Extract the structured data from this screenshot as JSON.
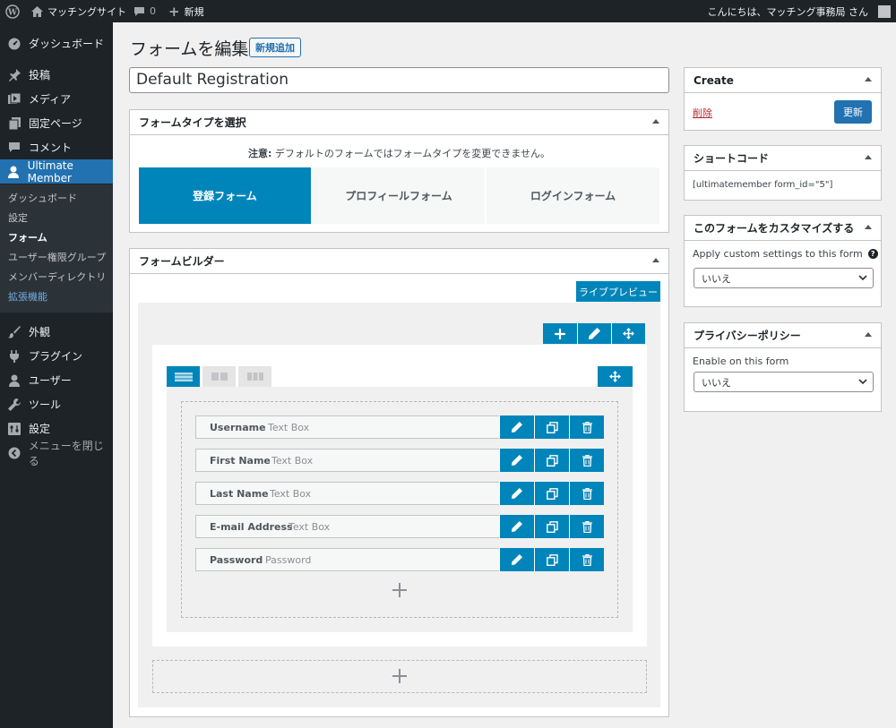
{
  "admin_bar": {
    "site_name": "マッチングサイト",
    "comments_count": "0",
    "new_label": "新規",
    "greeting": "こんにちは、マッチング事務局 さん"
  },
  "sidebar": {
    "items": [
      {
        "label": "ダッシュボード",
        "icon": "dashboard-icon"
      },
      {
        "label": "投稿",
        "icon": "pin-icon"
      },
      {
        "label": "メディア",
        "icon": "media-icon"
      },
      {
        "label": "固定ページ",
        "icon": "page-icon"
      },
      {
        "label": "コメント",
        "icon": "comment-icon"
      },
      {
        "label": "Ultimate Member",
        "icon": "user-icon"
      }
    ],
    "submenu": [
      "ダッシュボード",
      "設定",
      "フォーム",
      "ユーザー権限グループ",
      "メンバーディレクトリ",
      "拡張機能"
    ],
    "items2": [
      {
        "label": "外観",
        "icon": "brush-icon"
      },
      {
        "label": "プラグイン",
        "icon": "plugin-icon"
      },
      {
        "label": "ユーザー",
        "icon": "user-icon"
      },
      {
        "label": "ツール",
        "icon": "wrench-icon"
      },
      {
        "label": "設定",
        "icon": "settings-icon"
      }
    ],
    "collapse_label": "メニューを閉じる"
  },
  "page": {
    "title": "フォームを編集",
    "add_new": "新規追加",
    "form_title": "Default Registration"
  },
  "form_type": {
    "heading": "フォームタイプを選択",
    "notice_label": "注意:",
    "notice_text": " デフォルトのフォームではフォームタイプを変更できません。",
    "types": [
      "登録フォーム",
      "プロフィールフォーム",
      "ログインフォーム"
    ],
    "selected": "登録フォーム"
  },
  "builder": {
    "heading": "フォームビルダー",
    "live_preview": "ライブプレビュー",
    "fields": [
      {
        "label": "Username",
        "type": "Text Box"
      },
      {
        "label": "First Name",
        "type": "Text Box"
      },
      {
        "label": "Last Name",
        "type": "Text Box"
      },
      {
        "label": "E-mail Address",
        "type": "Text Box"
      },
      {
        "label": "Password",
        "type": "Password"
      }
    ]
  },
  "create_box": {
    "heading": "Create",
    "delete_label": "削除",
    "update_label": "更新"
  },
  "shortcode_box": {
    "heading": "ショートコード",
    "code": "[ultimatemember form_id=\"5\"]"
  },
  "customize_box": {
    "heading": "このフォームをカスタマイズする",
    "label": "Apply custom settings to this form",
    "value": "いいえ"
  },
  "privacy_box": {
    "heading": "プライバシーポリシー",
    "label": "Enable on this form",
    "value": "いいえ"
  },
  "colors": {
    "accent": "#0085ba",
    "admin_dark": "#1d2327",
    "primary": "#2271b1"
  }
}
